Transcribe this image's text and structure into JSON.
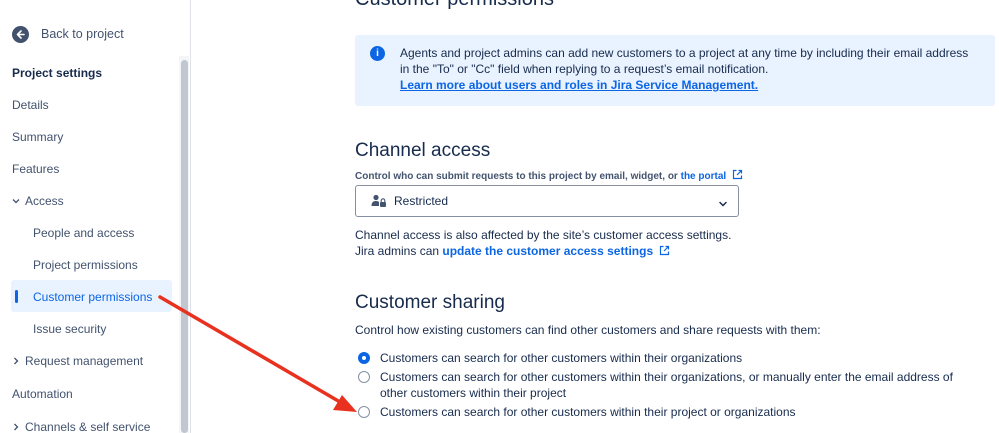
{
  "sidebar": {
    "back_label": "Back to project",
    "heading": "Project settings",
    "items": [
      {
        "label": "Details"
      },
      {
        "label": "Summary"
      },
      {
        "label": "Features"
      },
      {
        "label": "Access"
      },
      {
        "label": "People and access"
      },
      {
        "label": "Project permissions"
      },
      {
        "label": "Customer permissions"
      },
      {
        "label": "Issue security"
      },
      {
        "label": "Request management"
      },
      {
        "label": "Automation"
      },
      {
        "label": "Channels & self service"
      }
    ]
  },
  "main": {
    "page_title": "Customer permissions",
    "info": {
      "text": "Agents and project admins can add new customers to a project at any time by including their email address in the \"To\" or \"Cc\" field when replying to a request’s email notification.",
      "link": "Learn more about users and roles in Jira Service Management."
    },
    "channel_access": {
      "title": "Channel access",
      "caption": "Control who can submit requests to this project by email, widget, or ",
      "caption_link": "the portal",
      "select_value": "Restricted",
      "note_line1": "Channel access is also affected by the site’s customer access settings.",
      "note_line2_prefix": "Jira admins can ",
      "note_line2_link": "update the customer access settings"
    },
    "customer_sharing": {
      "title": "Customer sharing",
      "description": "Control how existing customers can find other customers and share requests with them:",
      "options": [
        {
          "label": "Customers can search for other customers within their organizations",
          "selected": true
        },
        {
          "label": "Customers can search for other customers within their organizations, or manually enter the email address of other customers within their project",
          "selected": false
        },
        {
          "label": "Customers can search for other customers within their project or organizations",
          "selected": false
        }
      ]
    }
  },
  "colors": {
    "accent": "#0c66e4",
    "info_bg": "#e9f2ff",
    "annotation_arrow": "#e8321f"
  },
  "icons": {
    "back": "arrow-left-circle-icon",
    "info": "info-icon",
    "external": "external-link-icon",
    "restricted": "person-lock-icon",
    "dropdown": "chevron-down-icon"
  }
}
